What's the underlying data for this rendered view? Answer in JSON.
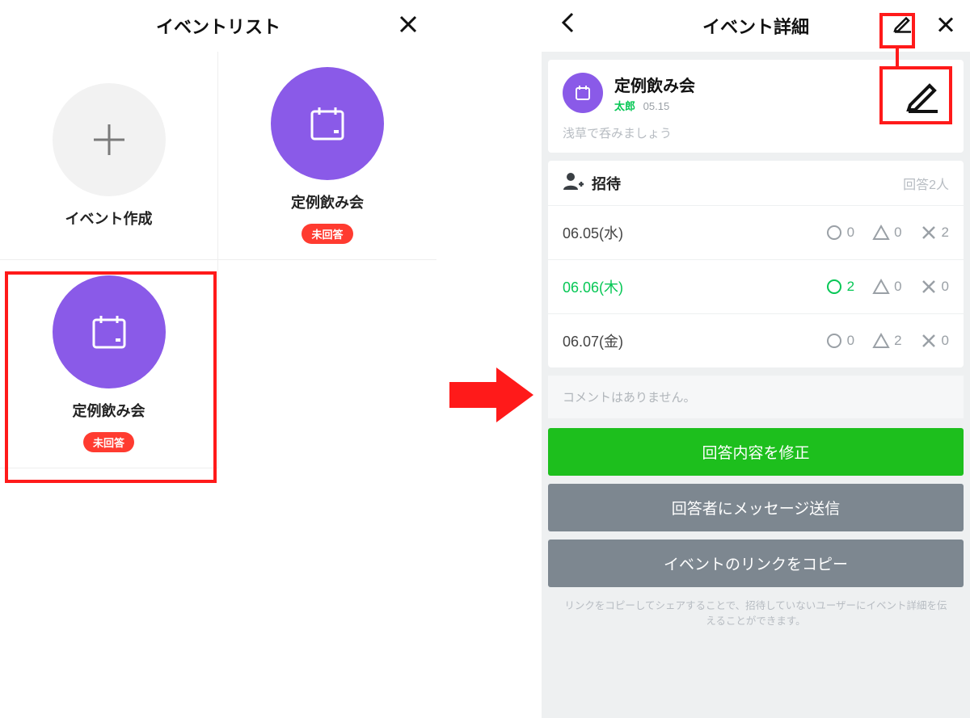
{
  "left": {
    "title": "イベントリスト",
    "tiles": {
      "create_label": "イベント作成",
      "event_label": "定例飲み会",
      "badge": "未回答"
    }
  },
  "right": {
    "title": "イベント詳細",
    "event": {
      "name": "定例飲み会",
      "author": "太郎",
      "created": "05.15",
      "desc": "浅草で呑みましょう"
    },
    "invite_label": "招待",
    "answer_count": "回答2人",
    "dates": [
      {
        "label": "06.05(水)",
        "o": 0,
        "t": 0,
        "x": 2,
        "highlight": false
      },
      {
        "label": "06.06(木)",
        "o": 2,
        "t": 0,
        "x": 0,
        "highlight": true
      },
      {
        "label": "06.07(金)",
        "o": 0,
        "t": 2,
        "x": 0,
        "highlight": false
      }
    ],
    "no_comments": "コメントはありません。",
    "buttons": {
      "edit_answer": "回答内容を修正",
      "send_msg": "回答者にメッセージ送信",
      "copy_link": "イベントのリンクをコピー"
    },
    "hint": "リンクをコピーしてシェアすることで、招待していないユーザーにイベント詳細を伝えることができます。"
  }
}
